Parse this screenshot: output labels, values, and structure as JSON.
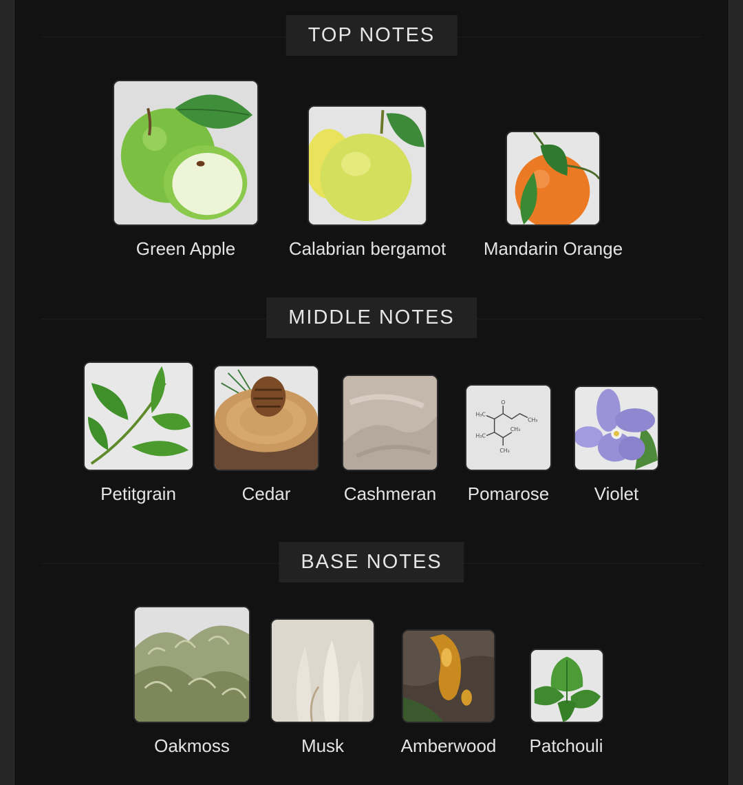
{
  "sections": {
    "top": {
      "title": "TOP NOTES",
      "items": [
        {
          "label": "Green Apple",
          "icon": "green-apple"
        },
        {
          "label": "Calabrian bergamot",
          "icon": "bergamot"
        },
        {
          "label": "Mandarin Orange",
          "icon": "mandarin-orange"
        }
      ]
    },
    "middle": {
      "title": "MIDDLE NOTES",
      "items": [
        {
          "label": "Petitgrain",
          "icon": "petitgrain-leaves"
        },
        {
          "label": "Cedar",
          "icon": "cedar-log-pinecone"
        },
        {
          "label": "Cashmeran",
          "icon": "cashmere-fabric"
        },
        {
          "label": "Pomarose",
          "icon": "molecule-diagram"
        },
        {
          "label": "Violet",
          "icon": "violet-flower"
        }
      ]
    },
    "base": {
      "title": "BASE NOTES",
      "items": [
        {
          "label": "Oakmoss",
          "icon": "oakmoss-lichen"
        },
        {
          "label": "Musk",
          "icon": "musk-fur"
        },
        {
          "label": "Amberwood",
          "icon": "amber-resin"
        },
        {
          "label": "Patchouli",
          "icon": "patchouli-leaf"
        }
      ]
    }
  },
  "colors": {
    "background": "#121212",
    "title_box": "#222222",
    "text": "#e4e4e4"
  }
}
